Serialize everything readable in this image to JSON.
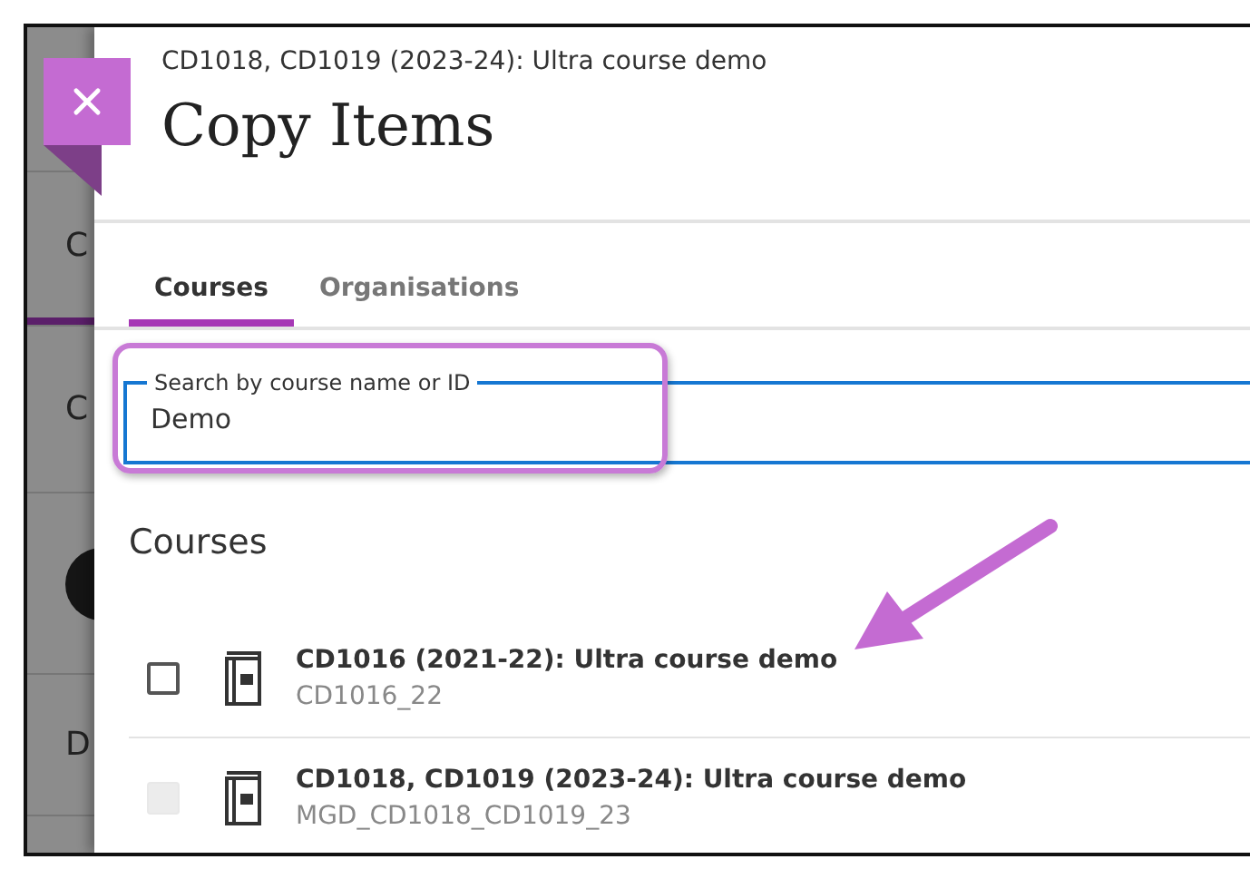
{
  "background": {
    "tab_letters": "C",
    "heading_letter": "C",
    "footer_letter": "D"
  },
  "header": {
    "subtitle": "CD1018, CD1019 (2023-24): Ultra course demo",
    "title": "Copy Items"
  },
  "tabs": [
    {
      "label": "Courses",
      "selected": true
    },
    {
      "label": "Organisations",
      "selected": false
    }
  ],
  "search": {
    "label": "Search by course name or ID",
    "value": "Demo"
  },
  "section_title": "Courses",
  "courses": [
    {
      "title": "CD1016 (2021-22): Ultra course demo",
      "id": "CD1016_22",
      "checked": false,
      "disabled": false
    },
    {
      "title": "CD1018, CD1019 (2023-24): Ultra course demo",
      "id": "MGD_CD1018_CD1019_23",
      "checked": false,
      "disabled": true
    }
  ]
}
